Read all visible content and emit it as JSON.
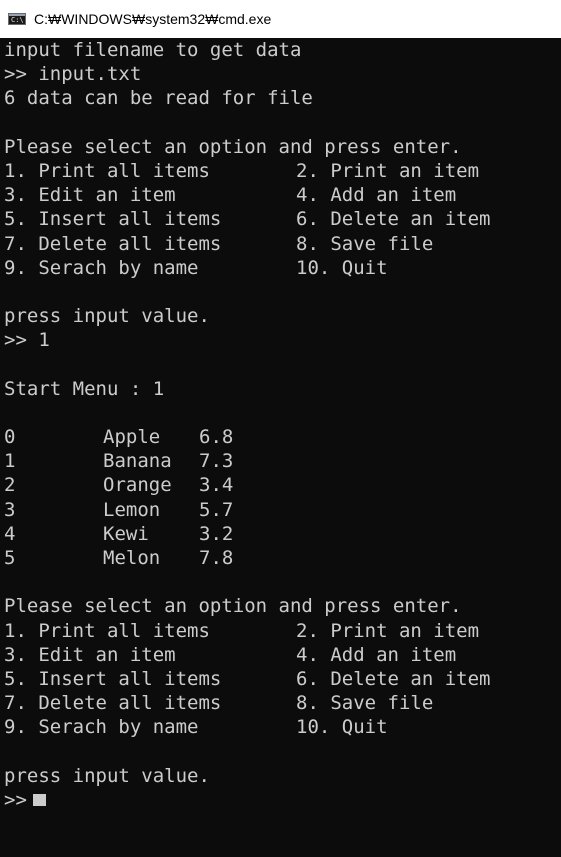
{
  "window": {
    "title": "C:₩WINDOWS₩system32₩cmd.exe",
    "icon_label": "C:\\"
  },
  "console": {
    "intro": {
      "prompt_line": "input filename to get data",
      "entry_line": ">> input.txt",
      "count_line": "6 data can be read for file"
    },
    "menu1": {
      "header": "Please select an option and press enter.",
      "rows": [
        {
          "left": "1. Print all items",
          "right": "2. Print an item"
        },
        {
          "left": "3. Edit an item",
          "right": "4. Add an item"
        },
        {
          "left": "5. Insert all items",
          "right": "6. Delete an item"
        },
        {
          "left": "7. Delete all items",
          "right": "8. Save file"
        },
        {
          "left": "9. Serach by name",
          "right": "10. Quit"
        }
      ]
    },
    "input1": {
      "prompt": "press input value.",
      "entry": ">> 1"
    },
    "start_menu": "Start Menu : 1",
    "items": [
      {
        "index": "0",
        "name": "Apple",
        "value": "6.8"
      },
      {
        "index": "1",
        "name": "Banana",
        "value": "7.3"
      },
      {
        "index": "2",
        "name": "Orange",
        "value": "3.4"
      },
      {
        "index": "3",
        "name": "Lemon",
        "value": "5.7"
      },
      {
        "index": "4",
        "name": "Kewi",
        "value": "3.2"
      },
      {
        "index": "5",
        "name": "Melon",
        "value": "7.8"
      }
    ],
    "menu2": {
      "header": "Please select an option and press enter.",
      "rows": [
        {
          "left": "1. Print all items",
          "right": "2. Print an item"
        },
        {
          "left": "3. Edit an item",
          "right": "4. Add an item"
        },
        {
          "left": "5. Insert all items",
          "right": "6. Delete an item"
        },
        {
          "left": "7. Delete all items",
          "right": "8. Save file"
        },
        {
          "left": "9. Serach by name",
          "right": "10. Quit"
        }
      ]
    },
    "input2": {
      "prompt": "press input value.",
      "entry": ">>"
    }
  },
  "colors": {
    "console_bg": "#0c0c0c",
    "console_text": "#cccccc",
    "titlebar_bg": "#ffffff"
  }
}
